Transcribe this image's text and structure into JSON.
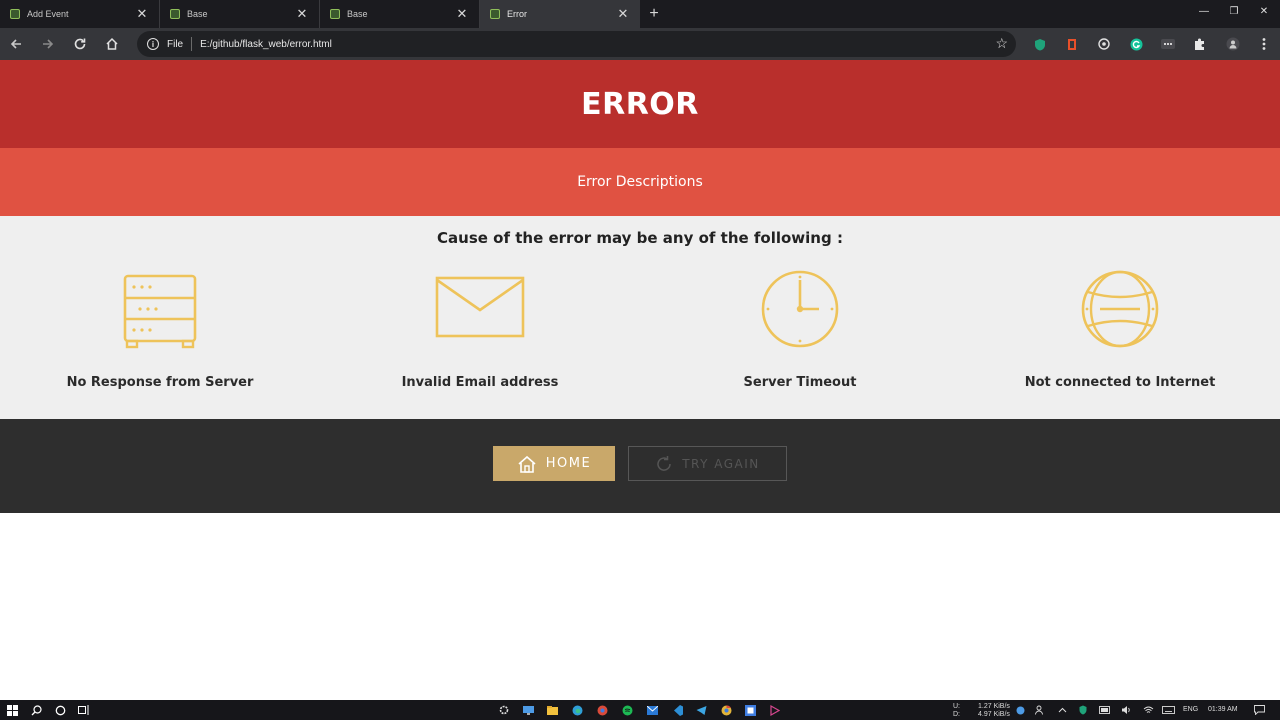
{
  "browser": {
    "tabs": [
      {
        "title": "Add Event",
        "active": false
      },
      {
        "title": "Base",
        "active": false
      },
      {
        "title": "Base",
        "active": false
      },
      {
        "title": "Error",
        "active": true
      }
    ],
    "new_tab_symbol": "+",
    "address": {
      "protocol_label": "File",
      "url": "E:/github/flask_web/error.html"
    }
  },
  "page": {
    "header_title": "ERROR",
    "subheader": "Error Descriptions",
    "cause_heading": "Cause of the error may be any of the following :",
    "causes": [
      {
        "label": "No Response from Server",
        "icon": "server-icon"
      },
      {
        "label": "Invalid Email address",
        "icon": "envelope-icon"
      },
      {
        "label": "Server Timeout",
        "icon": "clock-icon"
      },
      {
        "label": "Not connected to Internet",
        "icon": "globe-icon"
      }
    ],
    "buttons": {
      "home": "HOME",
      "try_again": "TRY AGAIN"
    }
  },
  "taskbar": {
    "net_up_label": "U:",
    "net_down_label": "D:",
    "net_up": "1.27 KiB/s",
    "net_down": "4.97 KiB/s",
    "language": "ENG",
    "time": "01:39 AM"
  },
  "colors": {
    "header": "#b92f2c",
    "subheader": "#e05242",
    "content_bg": "#efefef",
    "icon_gold": "#eec35a",
    "footer": "#2e2e2e",
    "home_button": "#c9a86a"
  }
}
